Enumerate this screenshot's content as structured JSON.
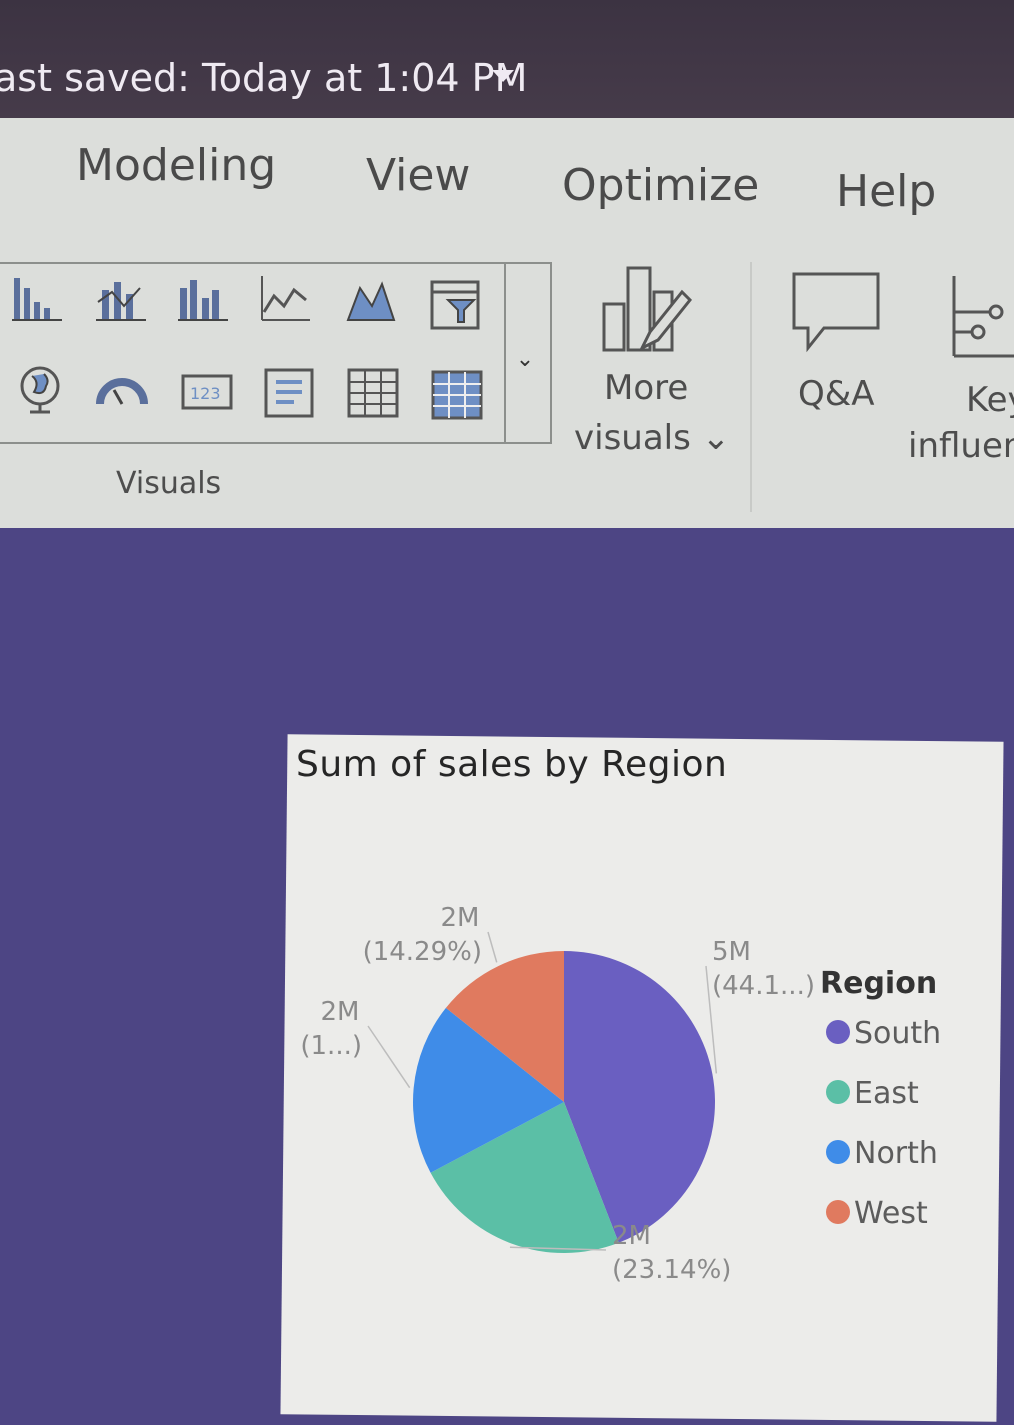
{
  "titlebar": {
    "last_saved": "ast saved: Today at 1:04 PM"
  },
  "ribbon": {
    "tabs": [
      {
        "label": "Modeling"
      },
      {
        "label": "View"
      },
      {
        "label": "Optimize"
      },
      {
        "label": "Help"
      }
    ],
    "visuals_group_label": "Visuals",
    "gallery_expand_glyph": "⌄",
    "visual_icons": [
      "stacked-bar-chart-icon",
      "stacked-column-chart-icon",
      "clustered-column-chart-icon",
      "line-chart-icon",
      "area-chart-icon",
      "funnel-filter-icon",
      "map-globe-icon",
      "gauge-icon",
      "card-123-icon",
      "multirow-card-icon",
      "table-icon",
      "matrix-icon"
    ],
    "more_visuals": {
      "line1": "More",
      "line2": "visuals ⌄"
    },
    "qa": {
      "label": "Q&A"
    },
    "key_influencers": {
      "line1": "Key",
      "line2": "influen"
    }
  },
  "chart": {
    "title": "Sum of sales by Region",
    "legend_title": "Region",
    "colors": {
      "South": "#6a5fc1",
      "East": "#5bbfa6",
      "North": "#3f8ce8",
      "West": "#e07a5f"
    }
  },
  "chart_data": {
    "type": "pie",
    "categories": [
      "South",
      "East",
      "North",
      "West"
    ],
    "values": [
      44.1,
      23.14,
      18.47,
      14.29
    ],
    "data_labels": [
      {
        "category": "South",
        "value": "5M",
        "pct": "(44.1...)"
      },
      {
        "category": "East",
        "value": "2M",
        "pct": "(23.14%)"
      },
      {
        "category": "North",
        "value": "2M",
        "pct": "(1...)"
      },
      {
        "category": "West",
        "value": "2M",
        "pct": "(14.29%)"
      }
    ],
    "title": "Sum of sales by Region",
    "legend": {
      "title": "Region",
      "placement": "right",
      "entries": [
        "South",
        "East",
        "North",
        "West"
      ]
    }
  }
}
